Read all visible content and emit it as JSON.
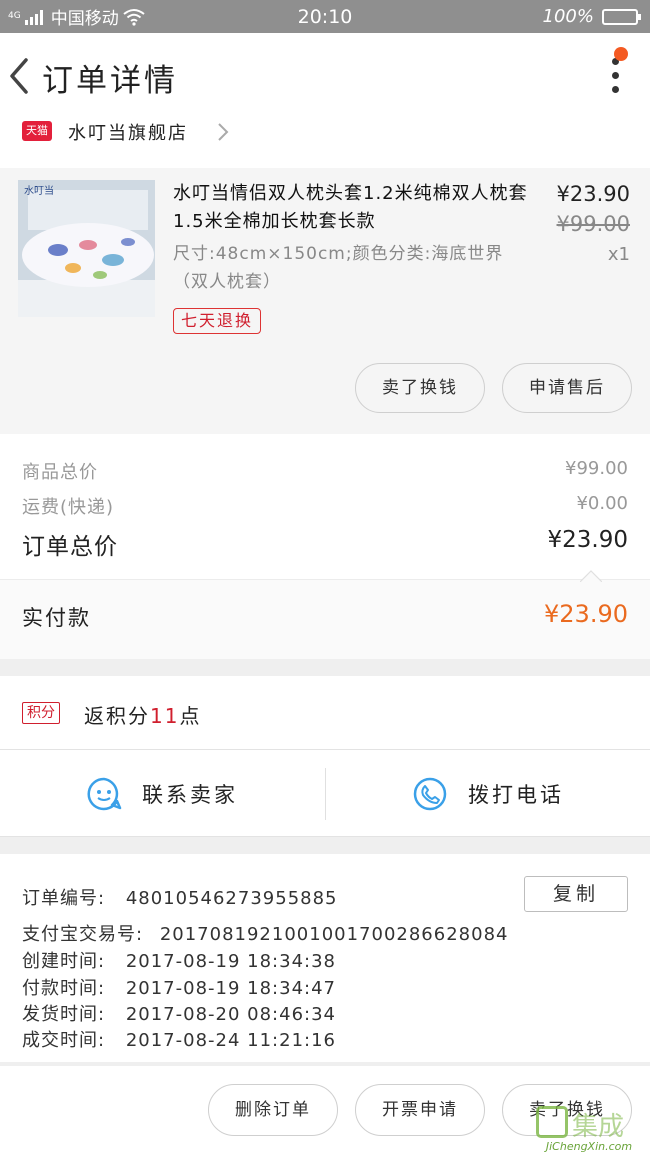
{
  "status_bar": {
    "network": "4G",
    "carrier": "中国移动",
    "time": "20:10",
    "battery": "100%",
    "battery_level": 1.0
  },
  "header": {
    "title": "订单详情",
    "back_icon": "chevron-left-icon",
    "more_icon": "more-vertical-icon",
    "notification_dot_color": "#f45a22"
  },
  "store": {
    "badge": "天猫",
    "name": "水叮当旗舰店"
  },
  "product": {
    "title": "水叮当情侣双人枕头套1.2米纯棉双人枕套1.5米全棉加长枕套长款",
    "spec": "尺寸:48cm×150cm;颜色分类:海底世界（双人枕套）",
    "return_tag": "七天退换",
    "price_now": "¥23.90",
    "price_old": "¥99.00",
    "quantity": "x1",
    "buttons": {
      "buy_again": "卖了换钱",
      "after_sale": "申请售后"
    }
  },
  "summary": {
    "goods_total_label": "商品总价",
    "goods_total": "¥99.00",
    "shipping_label": "运费(快递)",
    "shipping": "¥0.00",
    "order_total_label": "订单总价",
    "order_total": "¥23.90",
    "paid_label": "实付款",
    "paid": "¥23.90",
    "paid_color": "#ea6a1f"
  },
  "points": {
    "badge": "积分",
    "prefix": "返积分",
    "amount": "11",
    "suffix": "点"
  },
  "contact": {
    "seller_label": "联系卖家",
    "call_label": "拨打电话"
  },
  "order_info": {
    "order_no_label": "订单编号:",
    "order_no": "48010546273955885",
    "alipay_no_label": "支付宝交易号:",
    "alipay_no": "2017081921001001700286628084",
    "created_label": "创建时间:",
    "created": "2017-08-19 18:34:38",
    "paid_label": "付款时间:",
    "paid": "2017-08-19 18:34:47",
    "shipped_label": "发货时间:",
    "shipped": "2017-08-20 08:46:34",
    "completed_label": "成交时间:",
    "completed": "2017-08-24 11:21:16",
    "copy_button": "复制"
  },
  "bottom_bar": {
    "delete_order": "删除订单",
    "invoice": "开票申请",
    "buy_again": "卖了换钱"
  },
  "watermark": {
    "text": "集成",
    "url": "JiChengXin.com"
  }
}
